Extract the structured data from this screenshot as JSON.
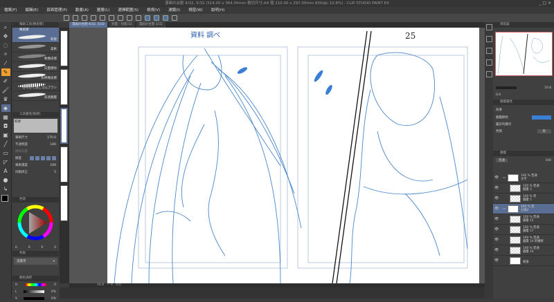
{
  "title": "漫画の台割 4/32, 5/32 (514.00 x 364.00mm 裁切尺寸:A4 寬 210.00 x 297.00mm 600dpi 10.8%) - CLIP STUDIO PAINT EX",
  "window_controls": "_ □ ×",
  "menu": [
    "檔案(F)",
    "編輯(E)",
    "頁面管理(P)",
    "動畫(A)",
    "圖層(L)",
    "選擇範圍(S)",
    "檢視(V)",
    "濾鏡(I)",
    "視窗(W)",
    "說明(H)"
  ],
  "tabs": [
    "漫画の台割 4/32, 5/32",
    "封面 - 封底/32",
    "漫画の台割 3/32"
  ],
  "sub_tool": {
    "panel_title": "輔助工具[橡皮擦]",
    "group": "橡皮擦",
    "items": [
      "較硬",
      "柔軟",
      "軟橡皮擦",
      "向量擦除",
      "對齊橡皮擦",
      "ざくざく消しゴムブラシ",
      "穿透圖層"
    ]
  },
  "tool_property": {
    "panel_title": "工具屬性[較硬]",
    "preset": "較硬",
    "brush_size_label": "筆刷尺寸",
    "brush_size": "170.0",
    "opacity_label": "不透明度",
    "opacity": "100",
    "hardness_label": "硬度",
    "density_label": "筆刷濃度",
    "density": "100",
    "vector_label": "擦除向量",
    "stabilization_label": "抖動修正",
    "stabilization": "5"
  },
  "color": {
    "wheel_tab": "色環",
    "values": [
      "0",
      "0",
      "0",
      "0"
    ],
    "set_tab": "色板",
    "set_name": "漫畫用",
    "slider_tab": "顏色滑桿",
    "h_label": "H",
    "h": "0",
    "l_label": "L",
    "l": "0%",
    "s_label": "S",
    "s": "0%",
    "main": "#000000",
    "sub": "#ffffff"
  },
  "canvas": {
    "handwriting": "資料 調べ",
    "page_number": "25"
  },
  "status": {
    "zoom": "10.8",
    "rotation": "0.0"
  },
  "navigator": {
    "tab": "導航器",
    "zoom": "10.8",
    "rotation": "0.0"
  },
  "layer_property": {
    "tab": "圖層屬性",
    "effect_label": "效果",
    "layer_color_label": "圖層顏色",
    "layer_color": "#3a7fd6",
    "display_label": "屬於的顯示",
    "tone_label": "色階",
    "tone_value": "黑"
  },
  "layers": {
    "tab": "圖層",
    "blend": "普通",
    "opacity": "100",
    "items": [
      {
        "line1": "100 % 普通",
        "line2": "文字",
        "folder": true
      },
      {
        "line1": "100 % 普通",
        "line2": "圖層 3"
      },
      {
        "line1": "100 % 普",
        "line2": "圖層 5"
      },
      {
        "line1": "100 % 普",
        "line2": "分格2",
        "folder": true,
        "active": true
      },
      {
        "line1": "100 % 普通",
        "line2": "圖層 15"
      },
      {
        "line1": "100 % 普通",
        "line2": "圖層 17"
      },
      {
        "line1": "100 % 普通",
        "line2": "圖層 14 的複製"
      },
      {
        "line1": "100 % 普通",
        "line2": "圖層 14"
      },
      {
        "line1": "",
        "line2": "紙張",
        "paper": true
      }
    ]
  }
}
